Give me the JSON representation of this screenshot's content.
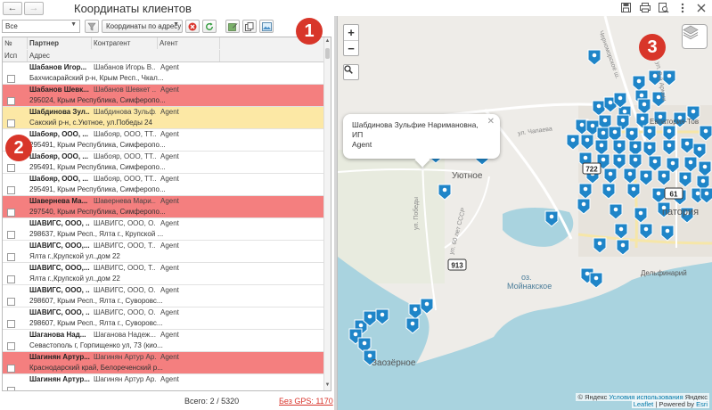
{
  "window": {
    "title": "Координаты клиентов"
  },
  "toolbar": {
    "filter_value": "Все",
    "mode_value": "Координаты по адресу"
  },
  "grid": {
    "headers": {
      "num": "№",
      "use": "Исп",
      "partner": "Партнер",
      "contractor": "Контрагент",
      "agent": "Агент",
      "address": "Адрес"
    },
    "rows": [
      {
        "partner": "Шабанов Игор...",
        "contractor": "Шабанов Игорь В...",
        "agent": "Agent",
        "address": "Бахчисарайский р-н, Крым Респ., Чкал...",
        "status": "normal"
      },
      {
        "partner": "Шабанов Шевк...",
        "contractor": "Шабанов Шевкет ...",
        "agent": "Agent",
        "address": "295024, Крым Республика, Симферопо...",
        "status": "red"
      },
      {
        "partner": "Шабдинова Зул...",
        "contractor": "Шабдинова Зульф...",
        "agent": "Agent",
        "address": "Сакский р-н, с.Уютное, ул.Победы 24",
        "status": "yellow"
      },
      {
        "partner": "Шабояр, ООО, ...",
        "contractor": "Шабояр, ООО, ТТ...",
        "agent": "Agent",
        "address": "295491, Крым Республика, Симферопо...",
        "status": "normal"
      },
      {
        "partner": "Шабояр, ООО, ...",
        "contractor": "Шабояр, ООО, ТТ...",
        "agent": "Agent",
        "address": "295491, Крым Республика, Симферопо...",
        "status": "normal"
      },
      {
        "partner": "Шабояр, ООО, ...",
        "contractor": "Шабояр, ООО, ТТ...",
        "agent": "Agent",
        "address": "295491, Крым Республика, Симферопо...",
        "status": "normal"
      },
      {
        "partner": "Шавернева Ма...",
        "contractor": "Шавернева Мари...",
        "agent": "Agent",
        "address": "297540, Крым Республика, Симферопо...",
        "status": "red"
      },
      {
        "partner": "ШАВИГС, ООО, ...",
        "contractor": "ШАВИГС, ООО, О...",
        "agent": "Agent",
        "address": "298637, Крым Респ., Ялта г., Крупской ...",
        "status": "normal"
      },
      {
        "partner": "ШАВИГС, ООО,...",
        "contractor": "ШАВИГС, ООО, Т...",
        "agent": "Agent",
        "address": "Ялта г.,Крупской ул.,дом 22",
        "status": "normal"
      },
      {
        "partner": "ШАВИГС, ООО,...",
        "contractor": "ШАВИГС, ООО, Т...",
        "agent": "Agent",
        "address": "Ялта г.,Крупской ул.,дом 22",
        "status": "normal"
      },
      {
        "partner": "ШАВИГС, ООО, ...",
        "contractor": "ШАВИГС, ООО, О...",
        "agent": "Agent",
        "address": "298607, Крым Респ., Ялта г., Суворовс...",
        "status": "normal"
      },
      {
        "partner": "ШАВИГС, ООО, ...",
        "contractor": "ШАВИГС, ООО, О...",
        "agent": "Agent",
        "address": "298607, Крым Респ., Ялта г., Суворовс...",
        "status": "normal"
      },
      {
        "partner": "Шаганова Над...",
        "contractor": "Шаганова Надеж...",
        "agent": "Agent",
        "address": "Севастополь г, Горпищенко ул, 73 (кио...",
        "status": "normal"
      },
      {
        "partner": "Шагинян Артур...",
        "contractor": "Шагинян Артур Ар...",
        "agent": "Agent",
        "address": "Краснодарский край, Белореченский р...",
        "status": "red"
      },
      {
        "partner": "Шагинян Артур...",
        "contractor": "Шагинян Артур Ар...",
        "agent": "Agent",
        "address": "",
        "status": "normal"
      }
    ]
  },
  "footer": {
    "total": "Всего: 2 / 5320",
    "gps": "Без GPS: 1170"
  },
  "map": {
    "popup_line1": "Шабдинова Зульфие Наримановна, ИП",
    "popup_line2": "Agent",
    "zoom_in": "+",
    "zoom_out": "−",
    "places": {
      "uyutnoe": "Уютное",
      "evpatoria_top": "Евпатория-Тов",
      "evpatoria": "патория",
      "moynakskoe_1": "оз.",
      "moynakskoe_2": "Мойнакское",
      "delfinarium": "Дельфинарий",
      "ozernoe": "Заозёрное",
      "street_chapaeva": "ул. Чапаева",
      "street_pobedy": "ул. Победы",
      "street_60let": "ул. 60 лет СССР",
      "street_chernomorskoe": "Черноморское ш.",
      "street_armii": "ул. 9-й Армии"
    },
    "cluster_labels": [
      "722",
      "61",
      "913"
    ],
    "attribution": "© Яндекс",
    "attribution_link": "Условия использования",
    "attribution_tail": "Яндекс",
    "leaflet_link": "Leaflet",
    "powered": "| Powered by",
    "esri_link": "Esri"
  },
  "annotations": [
    "1",
    "2",
    "3"
  ],
  "colors": {
    "marker": "#1f85c8",
    "water": "#a9d3df",
    "row_red": "#f47f7f",
    "row_yellow": "#fce8a5",
    "badge": "#d8362a"
  }
}
